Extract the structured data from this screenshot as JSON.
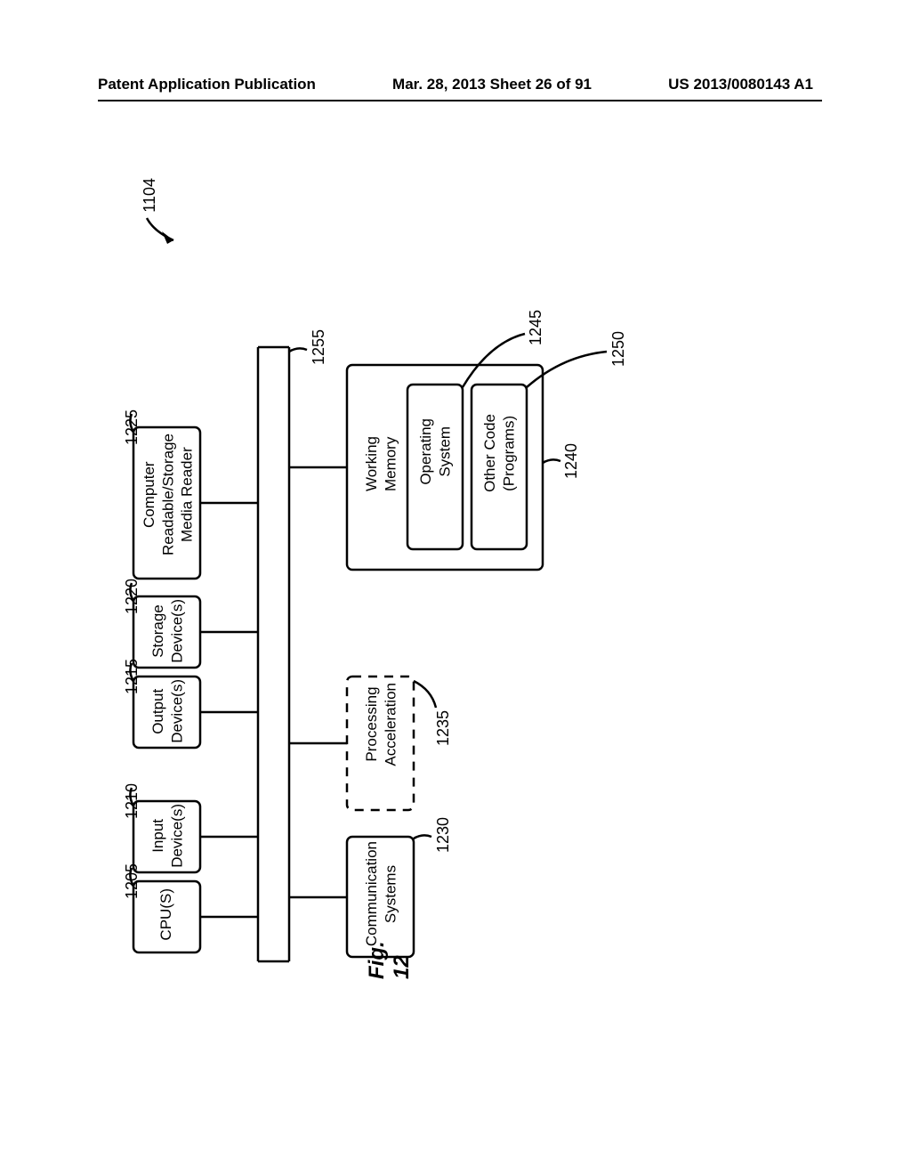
{
  "header": {
    "left": "Patent Application Publication",
    "center": "Mar. 28, 2013  Sheet 26 of 91",
    "right": "US 2013/0080143 A1"
  },
  "figure": {
    "label": "Fig. 12",
    "overall_ref": "1104",
    "blocks": {
      "cpu": {
        "label": "CPU(S)",
        "ref": "1205"
      },
      "input": {
        "label": "Input\nDevice(s)",
        "ref": "1210"
      },
      "output": {
        "label": "Output\nDevice(s)",
        "ref": "1215"
      },
      "storage": {
        "label": "Storage\nDevice(s)",
        "ref": "1220"
      },
      "reader": {
        "label": "Computer\nReadable/Storage\nMedia Reader",
        "ref": "1225"
      },
      "comm": {
        "label": "Communication\nSystems",
        "ref": "1230"
      },
      "accel": {
        "label": "Processing\nAcceleration",
        "ref": "1235"
      },
      "workmem": {
        "label": "Working\nMemory",
        "ref": "1240"
      },
      "os": {
        "label": "Operating\nSystem",
        "ref": "1245"
      },
      "other": {
        "label": "Other Code\n(Programs)",
        "ref": "1250"
      },
      "bus": {
        "ref": "1255"
      }
    }
  }
}
